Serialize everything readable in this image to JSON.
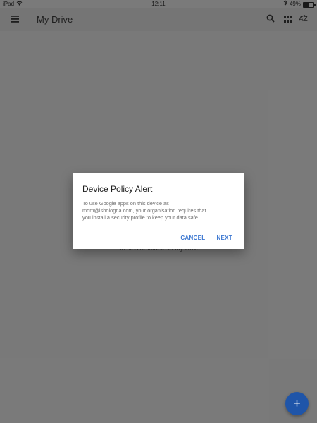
{
  "status_bar": {
    "carrier": "iPad",
    "time": "12:11",
    "battery_percent": "49%",
    "battery_level": 0.49
  },
  "app_bar": {
    "title": "My Drive",
    "icons": [
      "menu-icon",
      "search-icon",
      "grid-view-icon",
      "sort-az-icon"
    ],
    "sort_label": "AZ"
  },
  "content": {
    "empty_message": "No files or folders in My Drive"
  },
  "dialog": {
    "title": "Device Policy Alert",
    "body_lines": [
      "To use Google apps on this device as",
      "mdm@isbologna.com, your organisation requires that",
      "you install a security profile to keep your data safe."
    ],
    "cancel_label": "CANCEL",
    "next_label": "NEXT"
  },
  "fab": {
    "label": "+"
  },
  "colors": {
    "overlay": "#7c7c7c",
    "accent": "#3b77d1",
    "fab": "#1f55a9"
  }
}
